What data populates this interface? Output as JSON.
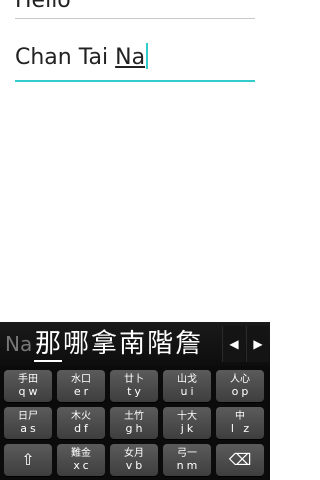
{
  "fields": {
    "previous_text": "Hello",
    "active_text_committed": "Chan Tai ",
    "active_text_composing": "Na"
  },
  "keyboard": {
    "composing_preview": "Na",
    "candidates": [
      "那",
      "哪",
      "拿",
      "南",
      "階",
      "詹"
    ],
    "rows": [
      [
        {
          "zh": "手田",
          "en": "qw"
        },
        {
          "zh": "水口",
          "en": "er"
        },
        {
          "zh": "廿卜",
          "en": "ty"
        },
        {
          "zh": "山戈",
          "en": "ui"
        },
        {
          "zh": "人心",
          "en": "op"
        }
      ],
      [
        {
          "zh": "日尸",
          "en": "as"
        },
        {
          "zh": "木火",
          "en": "df"
        },
        {
          "zh": "土竹",
          "en": "gh"
        },
        {
          "zh": "十大",
          "en": "jk"
        },
        {
          "zh": "中",
          "en": "l z"
        }
      ],
      [
        {
          "icon": "⇧"
        },
        {
          "zh": "難金",
          "en": "xc"
        },
        {
          "zh": "女月",
          "en": "vb"
        },
        {
          "zh": "弓一",
          "en": "nm"
        },
        {
          "icon": "⌫"
        }
      ]
    ],
    "arrow_left": "◀",
    "arrow_right": "▶"
  }
}
